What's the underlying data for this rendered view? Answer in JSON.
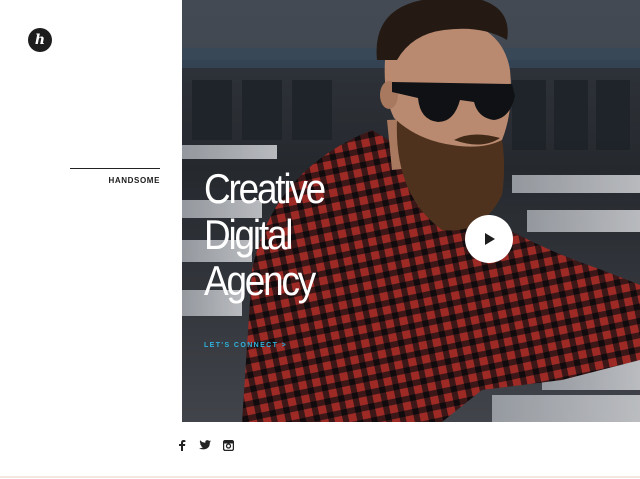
{
  "logo": {
    "letter": "h"
  },
  "sidebar": {
    "label": "HANDSOME"
  },
  "hero": {
    "headline": [
      "Creative",
      "Digital",
      "Agency"
    ],
    "cta_label": "LET'S CONNECT >"
  },
  "social": [
    {
      "icon": "facebook-icon"
    },
    {
      "icon": "twitter-icon"
    },
    {
      "icon": "instagram-icon"
    }
  ],
  "colors": {
    "accent": "#2fb2de",
    "shirt": "#b3302b",
    "dark": "#1d1d1d"
  }
}
